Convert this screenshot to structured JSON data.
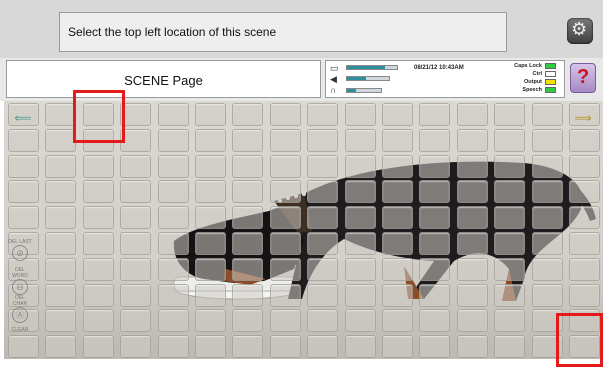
{
  "prompt": {
    "text": "Select the top left location of this scene"
  },
  "header": {
    "scene_title": "SCENE Page"
  },
  "status": {
    "datetime": "08/21/12 10:43AM",
    "meters": [
      {
        "icon": "calendar-icon",
        "level": 0.75
      },
      {
        "icon": "speaker-icon",
        "level": 0.45
      },
      {
        "icon": "headphones-icon",
        "level": 0.25
      }
    ],
    "indicators": [
      {
        "label": "Caps Lock",
        "color": "#2ecc40"
      },
      {
        "label": "Ctrl",
        "color": "#ffffff"
      },
      {
        "label": "Output",
        "color": "#f2e200"
      },
      {
        "label": "Speech",
        "color": "#2ecc40"
      }
    ]
  },
  "help": {
    "label": "?"
  },
  "side_buttons": [
    {
      "label": "DEL LAST",
      "glyph": "⊘"
    },
    {
      "label": "DEL WORD",
      "glyph": "⊖"
    },
    {
      "label": "DEL CHAR",
      "glyph": "Ⓐ"
    },
    {
      "label": "CLEAR",
      "glyph": ""
    }
  ],
  "colors": {
    "highlight": "#e41b1b",
    "meter_fill": "#2f8f9f",
    "help_question": "#d0101a"
  }
}
